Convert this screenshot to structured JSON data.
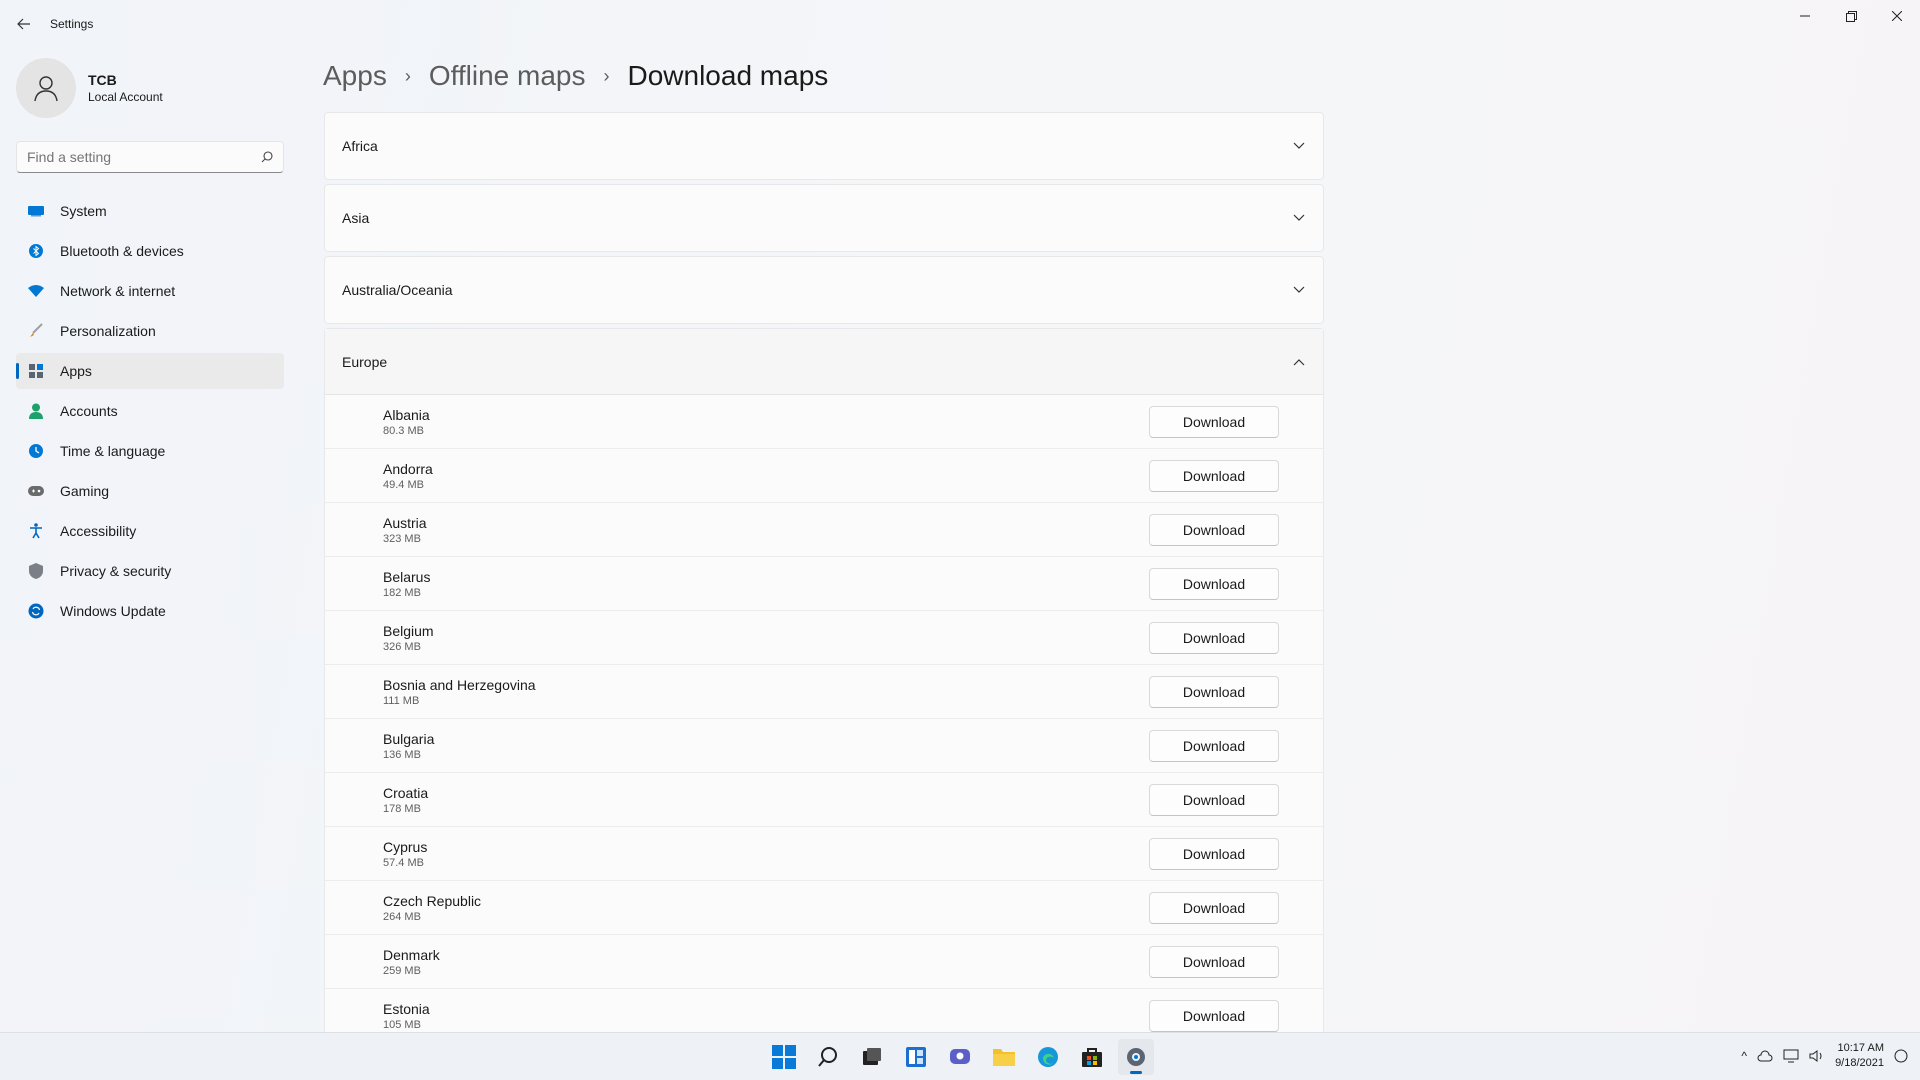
{
  "window": {
    "title": "Settings",
    "controls": {
      "minimize": "minimize-icon",
      "restore": "restore-icon",
      "close": "close-icon"
    }
  },
  "profile": {
    "name": "TCB",
    "account_type": "Local Account"
  },
  "search": {
    "placeholder": "Find a setting"
  },
  "nav": {
    "items": [
      {
        "label": "System",
        "icon": "system-icon",
        "color": "#0078d4"
      },
      {
        "label": "Bluetooth & devices",
        "icon": "bluetooth-icon",
        "color": "#0078d4"
      },
      {
        "label": "Network & internet",
        "icon": "wifi-icon",
        "color": "#0078d4"
      },
      {
        "label": "Personalization",
        "icon": "brush-icon",
        "color": "#d08020"
      },
      {
        "label": "Apps",
        "icon": "apps-icon",
        "color": "#5a6472",
        "active": true
      },
      {
        "label": "Accounts",
        "icon": "person-icon",
        "color": "#1ca06c"
      },
      {
        "label": "Time & language",
        "icon": "globe-clock-icon",
        "color": "#0078d4"
      },
      {
        "label": "Gaming",
        "icon": "gamepad-icon",
        "color": "#6b6b6b"
      },
      {
        "label": "Accessibility",
        "icon": "accessibility-icon",
        "color": "#0067c0"
      },
      {
        "label": "Privacy & security",
        "icon": "shield-icon",
        "color": "#7a7f88"
      },
      {
        "label": "Windows Update",
        "icon": "update-icon",
        "color": "#0067c0"
      }
    ]
  },
  "breadcrumb": {
    "items": [
      "Apps",
      "Offline maps"
    ],
    "current": "Download maps"
  },
  "regions": [
    {
      "name": "Africa",
      "expanded": false
    },
    {
      "name": "Asia",
      "expanded": false
    },
    {
      "name": "Australia/Oceania",
      "expanded": false
    },
    {
      "name": "Europe",
      "expanded": true
    }
  ],
  "europe_countries": [
    {
      "name": "Albania",
      "size": "80.3 MB",
      "action": "Download"
    },
    {
      "name": "Andorra",
      "size": "49.4 MB",
      "action": "Download"
    },
    {
      "name": "Austria",
      "size": "323 MB",
      "action": "Download"
    },
    {
      "name": "Belarus",
      "size": "182 MB",
      "action": "Download"
    },
    {
      "name": "Belgium",
      "size": "326 MB",
      "action": "Download"
    },
    {
      "name": "Bosnia and Herzegovina",
      "size": "111 MB",
      "action": "Download"
    },
    {
      "name": "Bulgaria",
      "size": "136 MB",
      "action": "Download"
    },
    {
      "name": "Croatia",
      "size": "178 MB",
      "action": "Download"
    },
    {
      "name": "Cyprus",
      "size": "57.4 MB",
      "action": "Download"
    },
    {
      "name": "Czech Republic",
      "size": "264 MB",
      "action": "Download"
    },
    {
      "name": "Denmark",
      "size": "259 MB",
      "action": "Download"
    },
    {
      "name": "Estonia",
      "size": "105 MB",
      "action": "Download"
    }
  ],
  "taskbar": {
    "icons": [
      "windows-start-icon",
      "search-icon",
      "task-view-icon",
      "widgets-icon",
      "chat-icon",
      "file-explorer-icon",
      "edge-icon",
      "store-icon",
      "settings-icon"
    ],
    "tray": {
      "time": "10:17 AM",
      "date": "9/18/2021"
    }
  },
  "accent_color": "#0067c0"
}
